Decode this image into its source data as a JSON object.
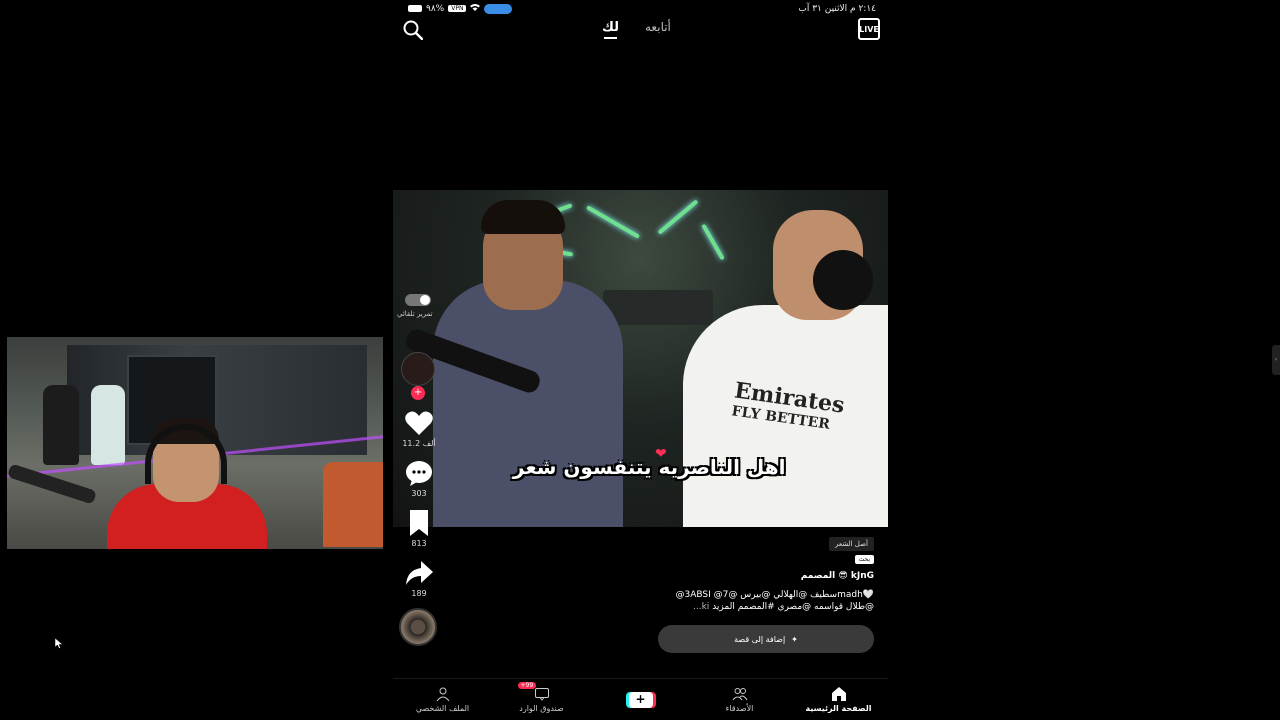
{
  "status_bar": {
    "datetime": "٢:١٤ م  الاثنين ٣١ آب",
    "battery": "٩٨%",
    "vpn": "VPN"
  },
  "top_nav": {
    "live_label": "LIVE",
    "tab_for_you": "لك",
    "tab_following": "أتابعه"
  },
  "video": {
    "caption_overlay": "اهل الناصريه يتنفسون شعر",
    "jersey_line1": "Emirates",
    "jersey_line2": "FLY BETTER"
  },
  "rail": {
    "autoscroll_label": "تمرير تلقائي",
    "likes": "11.2 ألف",
    "comments": "303",
    "saves": "813",
    "shares": "189"
  },
  "post": {
    "tag_original": "أصل الشعر",
    "tag_search": "بحث",
    "author": "kJnG 😎 المصمم",
    "caption_line1": "🤍madhسطيف @الهلالي @بيرس @7@ 3ABSI@",
    "caption_line2": "@طلال قواسمه @مصري #المصمم المزيد",
    "caption_more": "ki...",
    "add_story": "إضافة إلى قصة"
  },
  "bottom_nav": {
    "home": "الصفحة الرئيسية",
    "friends": "الأصدقاء",
    "inbox": "صندوق الوارد",
    "inbox_badge": "99+",
    "profile": "الملف الشخصي"
  },
  "colors": {
    "accent_red": "#fe2c55",
    "accent_cyan": "#25f4ee",
    "vpn_blue": "#3b8ee8"
  }
}
